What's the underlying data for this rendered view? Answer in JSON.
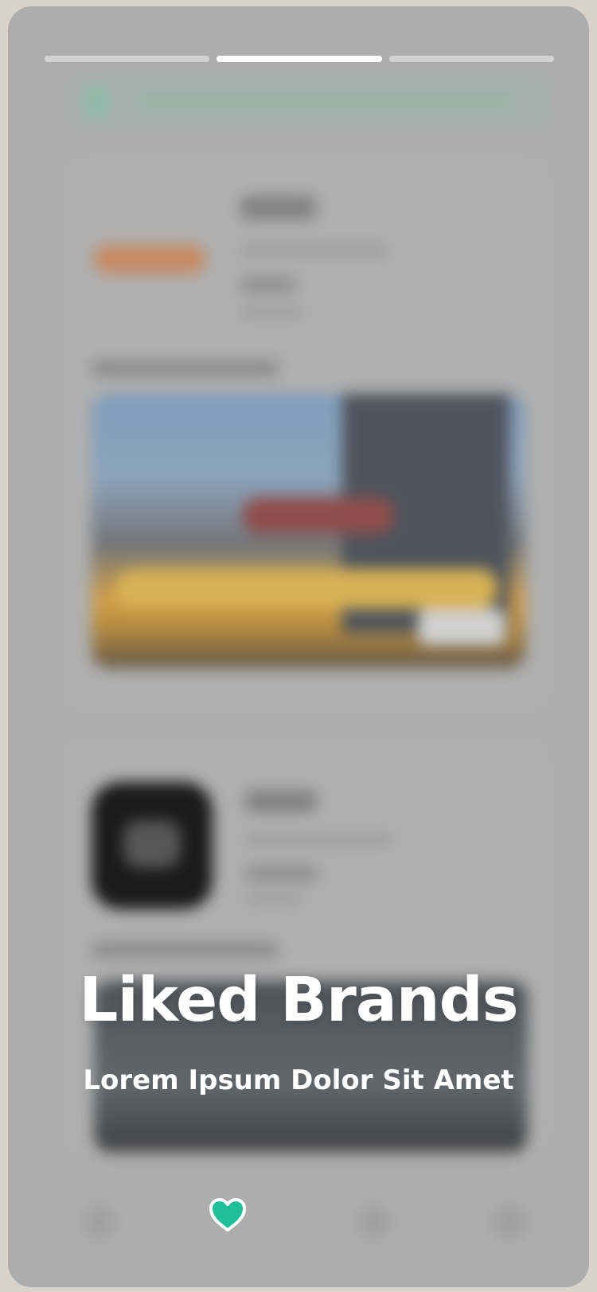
{
  "story": {
    "progress_segments": 3,
    "active_segment_index": 1,
    "title": "Liked Brands",
    "subtitle": "Lorem Ipsum Dolor Sit Amet"
  },
  "icons": {
    "liked": "heart-icon"
  },
  "colors": {
    "heart_fill": "#1fbf9a",
    "heart_outline": "#ffffff",
    "text": "#ffffff",
    "progress_active": "#ffffff",
    "progress_inactive": "#ffffff73"
  }
}
